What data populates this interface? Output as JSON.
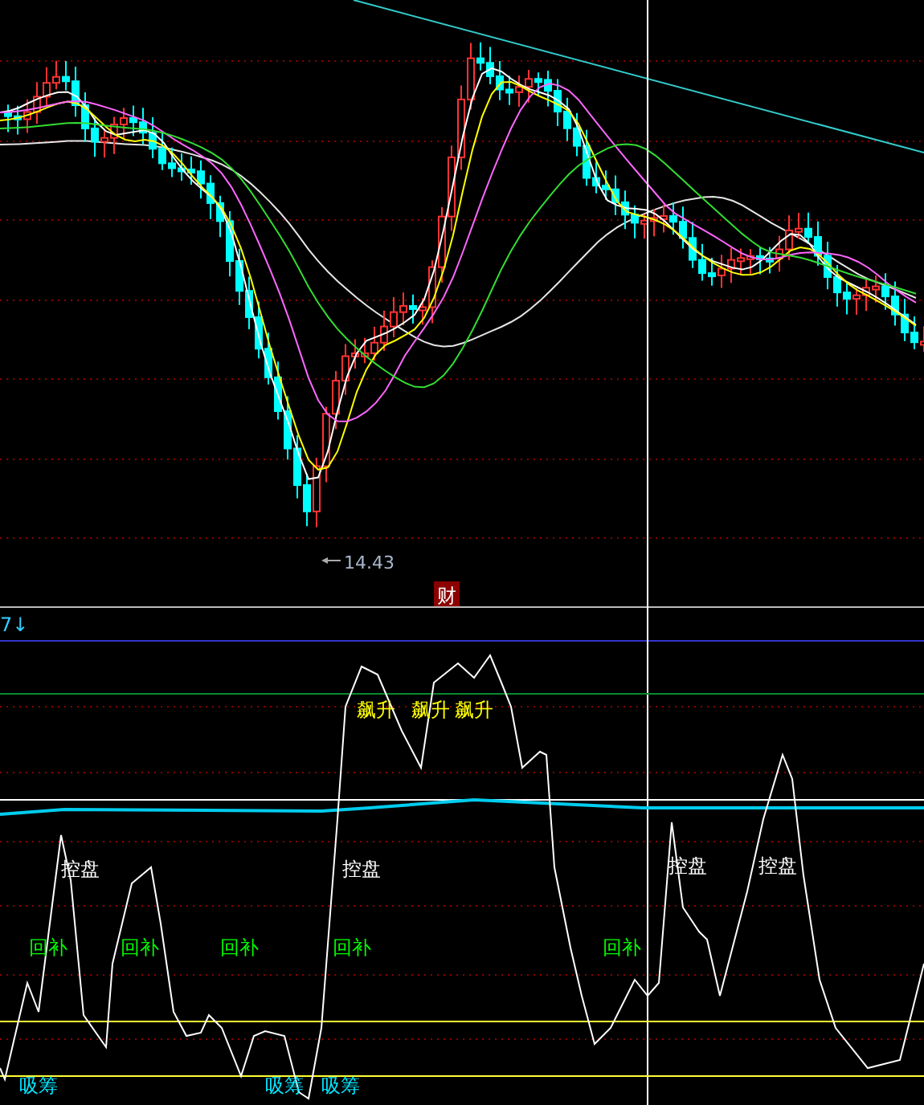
{
  "price_panel": {
    "low_label": "14.43",
    "marker": "财"
  },
  "indicator_panel": {
    "title": "7↓",
    "signals": [
      {
        "kind": "rise",
        "text": "飙升"
      },
      {
        "kind": "rise",
        "text": "飙升"
      },
      {
        "kind": "rise",
        "text": "飙升"
      },
      {
        "kind": "control",
        "text": "控盘"
      },
      {
        "kind": "control",
        "text": "控盘"
      },
      {
        "kind": "control",
        "text": "控盘"
      },
      {
        "kind": "control",
        "text": "控盘"
      },
      {
        "kind": "refill",
        "text": "回补"
      },
      {
        "kind": "refill",
        "text": "回补"
      },
      {
        "kind": "refill",
        "text": "回补"
      },
      {
        "kind": "refill",
        "text": "回补"
      },
      {
        "kind": "refill",
        "text": "回补"
      },
      {
        "kind": "absorb",
        "text": "吸筹"
      },
      {
        "kind": "absorb",
        "text": "吸筹"
      },
      {
        "kind": "absorb",
        "text": "吸筹"
      }
    ]
  }
}
